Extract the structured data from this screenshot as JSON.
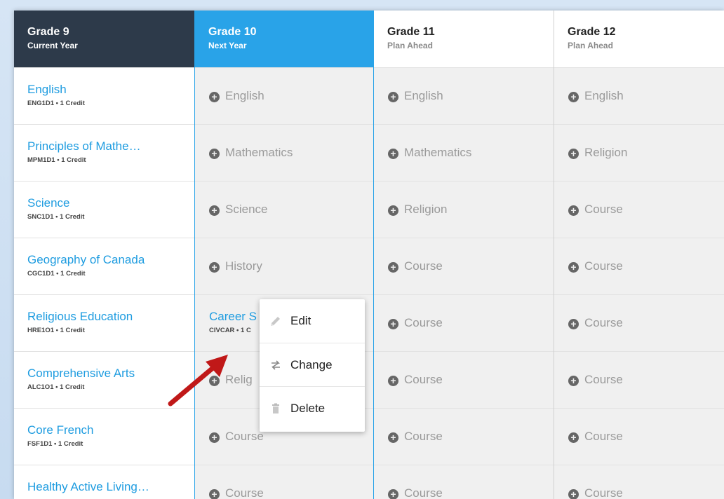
{
  "columns": [
    {
      "title": "Grade 9",
      "subtitle": "Current Year"
    },
    {
      "title": "Grade 10",
      "subtitle": "Next Year"
    },
    {
      "title": "Grade 11",
      "subtitle": "Plan Ahead"
    },
    {
      "title": "Grade 12",
      "subtitle": "Plan Ahead"
    }
  ],
  "grade9_courses": [
    {
      "name": "English",
      "code": "ENG1D1 • 1 Credit"
    },
    {
      "name": "Principles of Mathe…",
      "code": "MPM1D1 • 1 Credit"
    },
    {
      "name": "Science",
      "code": "SNC1D1 • 1 Credit"
    },
    {
      "name": "Geography of Canada",
      "code": "CGC1D1 • 1 Credit"
    },
    {
      "name": "Religious Education",
      "code": "HRE1O1 • 1 Credit"
    },
    {
      "name": "Comprehensive Arts",
      "code": "ALC1O1 • 1 Credit"
    },
    {
      "name": "Core French",
      "code": "FSF1D1 • 1 Credit"
    },
    {
      "name": "Healthy Active Living…",
      "code": ""
    }
  ],
  "grade10_slots": [
    "English",
    "Mathematics",
    "Science",
    "History",
    "",
    "Relig",
    "Course",
    "Course"
  ],
  "grade10_selected": {
    "name": "Career S",
    "code": "CIVCAR • 1 C"
  },
  "grade11_slots": [
    "English",
    "Mathematics",
    "Religion",
    "Course",
    "Course",
    "Course",
    "Course",
    "Course"
  ],
  "grade12_slots": [
    "English",
    "Religion",
    "Course",
    "Course",
    "Course",
    "Course",
    "Course",
    "Course"
  ],
  "context_menu": {
    "edit": "Edit",
    "change": "Change",
    "delete": "Delete"
  },
  "colors": {
    "accent": "#29a3e8",
    "header_dark": "#2d3a4a",
    "link": "#1e9ce0",
    "arrow": "#c01818"
  },
  "icons": {
    "add": "plus-circle-icon",
    "edit": "pencil-icon",
    "change": "swap-icon",
    "delete": "trash-icon"
  }
}
